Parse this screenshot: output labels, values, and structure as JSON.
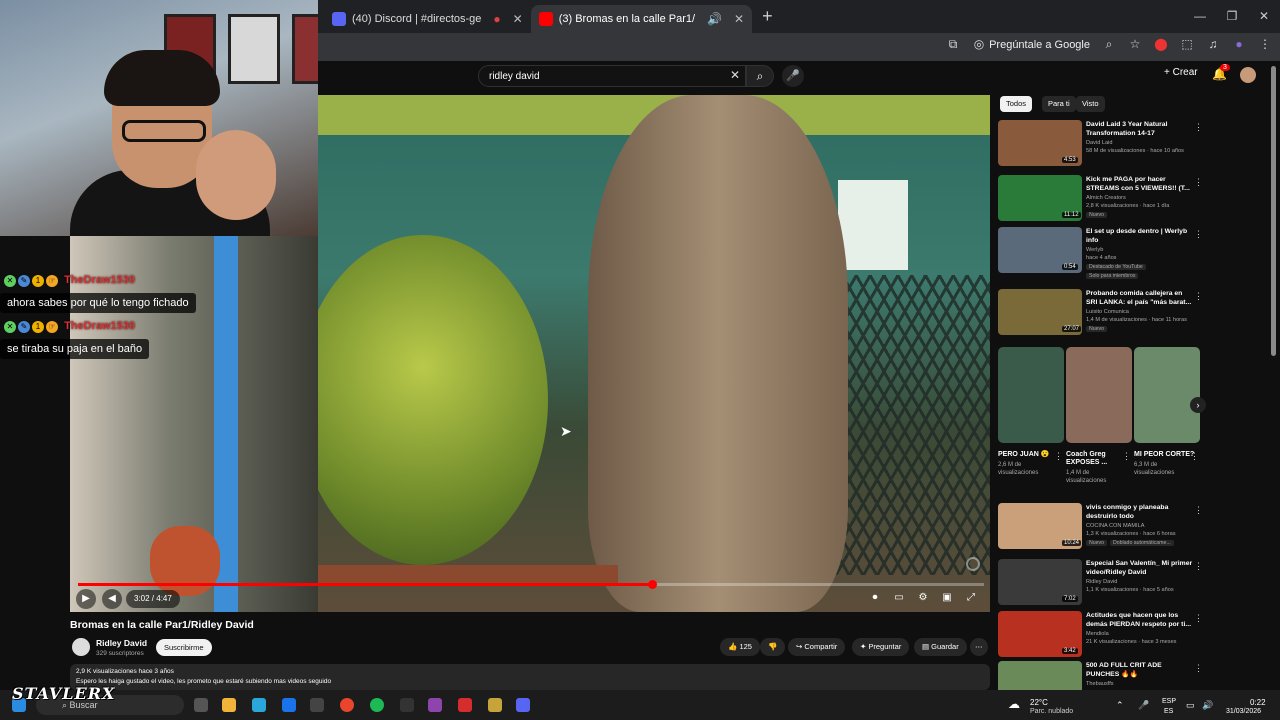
{
  "browser": {
    "tabs": [
      {
        "label": "(40) Discord | #directos-ge",
        "favicon_color": "#5865f2",
        "active": false
      },
      {
        "label": "(3) Bromas en la calle Par1/",
        "favicon_color": "#ff0000",
        "active": true
      }
    ],
    "new_tab": "+",
    "ask_google": "Pregúntale a Google"
  },
  "youtube": {
    "search": {
      "value": "ridley david"
    },
    "create_label": "Crear",
    "notifications_count": "3"
  },
  "chat": [
    {
      "user": "TheDraw1530",
      "message": "ahora sabes por qué lo tengo fichado"
    },
    {
      "user": "TheDraw1530",
      "message": "se tiraba su paja en el baño"
    }
  ],
  "player": {
    "current_time": "3:02",
    "duration": "4:47",
    "progress": 0.634
  },
  "video": {
    "title": "Bromas en la calle Par1/Ridley David",
    "channel": "Ridley David",
    "subscribers": "329 suscriptores",
    "subscribe_label": "Suscribirme",
    "likes": "125",
    "share_label": "Compartir",
    "ask_label": "Preguntar",
    "save_label": "Guardar",
    "views_age": "2,9 K visualizaciones  hace 3 años",
    "description": "Espero les haiga gustado el video, les prometo que estaré subiendo mas videos seguido"
  },
  "sidebar": {
    "chips": [
      "Todos",
      "Para ti",
      "Visto"
    ],
    "recs": [
      {
        "title": "David Laid 3 Year Natural Transformation 14-17",
        "channel": "David Laid",
        "meta": "58 M de visualizaciones · hace 10 años",
        "duration": "4:53",
        "color": "#8a5a3c",
        "badge": ""
      },
      {
        "title": "Kick me PAGA por hacer STREAMS con 5 VIEWERS!! (T...",
        "channel": "Almich Creators",
        "meta": "2,8 K visualizaciones · hace 1 día",
        "duration": "11:12",
        "color": "#2a7a3a",
        "badge": "Nuevo"
      },
      {
        "title": "El set up desde dentro | Werlyb info",
        "channel": "Werlyb",
        "meta": "hace 4 años",
        "duration": "0:54",
        "color": "#5a6a7a",
        "badge": "Destacado de YouTube",
        "extra": "Solo para miembros"
      },
      {
        "title": "Probando comida callejera en SRI LANKA: el país \"más barat...",
        "channel": "Luisito Comunica",
        "meta": "1,4 M de visualizaciones · hace 11 horas",
        "duration": "27:07",
        "color": "#7a6a3a",
        "badge": "Nuevo"
      },
      {
        "title": "vivis conmigo y planeaba destruirlo todo",
        "channel": "COCINA CON MAMILA",
        "meta": "1,3 K visualizaciones · hace 6 horas",
        "duration": "10:24",
        "color": "#c9a07a",
        "badge": "Nuevo",
        "extra": "Doblado automáticame..."
      },
      {
        "title": "Especial San Valentín_ Mi primer video/Ridley David",
        "channel": "Ridley David",
        "meta": "1,1 K visualizaciones · hace 5 años",
        "duration": "7:02",
        "color": "#3a3a3a",
        "badge": ""
      },
      {
        "title": "Actitudes que hacen que los demás PIERDAN respeto por ti...",
        "channel": "Mendiola",
        "meta": "21 K visualizaciones · hace 3 meses",
        "duration": "3:42",
        "color": "#b8301f",
        "badge": ""
      },
      {
        "title": "500 AD FULL CRIT ADE PUNCHES 🔥🔥",
        "channel": "Thebausffs",
        "meta": "",
        "duration": "",
        "color": "#6a8a5a",
        "badge": ""
      }
    ],
    "shorts": [
      {
        "title": "PERO JUAN 😮",
        "views": "2,6 M de visualizaciones",
        "color": "#3a5a4a"
      },
      {
        "title": "Coach Greg EXPOSES ...",
        "views": "1,4 M de visualizaciones",
        "color": "#8a6a5a"
      },
      {
        "title": "MI PEOR CORTE?",
        "views": "6,3 M de visualizaciones",
        "color": "#6a8a6a"
      }
    ]
  },
  "taskbar": {
    "search_label": "Buscar",
    "weather_temp": "22°C",
    "weather_desc": "Parc. nublado",
    "lang1": "ESP",
    "lang2": "ES",
    "time": "0:22",
    "date": "31/03/2026"
  },
  "overlay": {
    "streamer_logo": "STAVLERX"
  }
}
